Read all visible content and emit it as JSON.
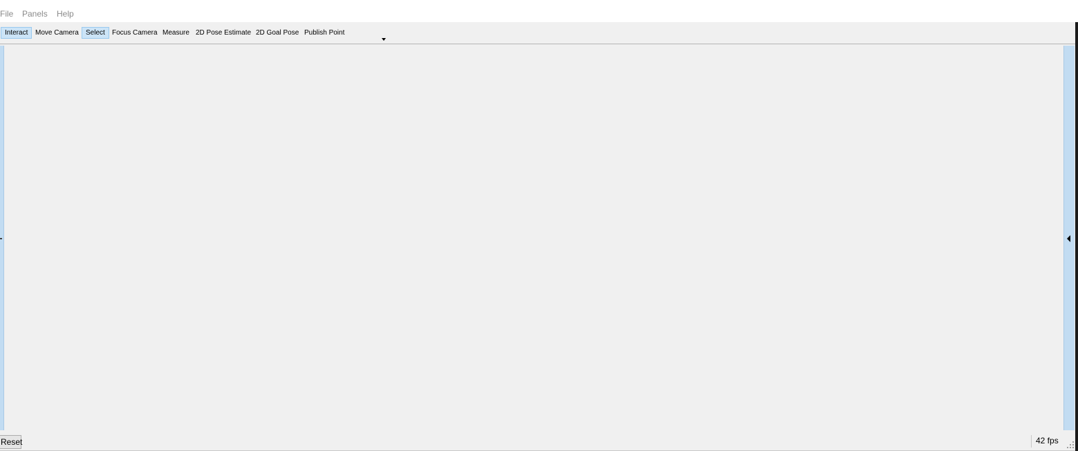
{
  "menubar": {
    "items": [
      "File",
      "Panels",
      "Help"
    ]
  },
  "toolbar": {
    "tools": [
      {
        "label": "Interact",
        "active": true
      },
      {
        "label": "Move Camera",
        "active": false
      },
      {
        "label": "Select",
        "active": true
      },
      {
        "label": "Focus Camera",
        "active": false
      },
      {
        "label": "Measure",
        "active": false
      },
      {
        "label": "2D Pose Estimate",
        "active": false
      },
      {
        "label": "2D Goal Pose",
        "active": false
      },
      {
        "label": "Publish Point",
        "active": false
      }
    ],
    "overflow_icon": "dropdown-arrow-icon"
  },
  "bottombar": {
    "reset_label": "Reset",
    "fps": "42 fps"
  },
  "colors": {
    "active_tool_bg": "#cce4f7",
    "splitter": "#c2dcf2",
    "background": "#f0f0f0"
  }
}
